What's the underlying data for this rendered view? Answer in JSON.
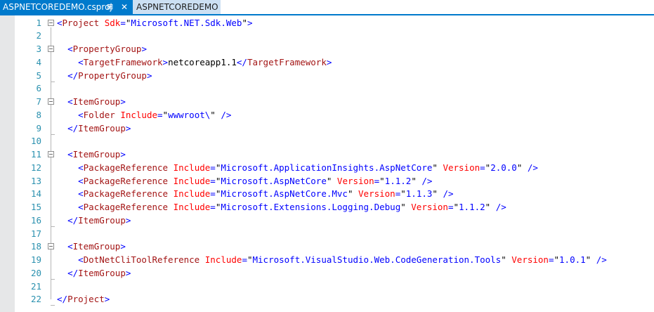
{
  "tabs": [
    {
      "label": "ASPNETCOREDEMO.csproj",
      "active": true,
      "pin_icon": "pin-icon",
      "close_icon": "close-icon"
    },
    {
      "label": "ASPNETCOREDEMO",
      "active": false
    }
  ],
  "colors": {
    "accent": "#007acc",
    "line_number": "#2b91af",
    "tag": "#a31515",
    "attribute": "#ff0000",
    "punctuation": "#0000ff"
  },
  "editor": {
    "line_numbers": [
      "1",
      "2",
      "3",
      "4",
      "5",
      "6",
      "7",
      "8",
      "9",
      "10",
      "11",
      "12",
      "13",
      "14",
      "15",
      "16",
      "17",
      "18",
      "19",
      "20",
      "21",
      "22"
    ],
    "lines": {
      "l1": {
        "open": "<",
        "tag": "Project",
        "sp": " ",
        "attr1": "Sdk",
        "eq1": "=",
        "q1a": "\"",
        "val1": "Microsoft.NET.Sdk.Web",
        "q1b": "\"",
        "close": ">"
      },
      "l3": {
        "indent": "  ",
        "open": "<",
        "tag": "PropertyGroup",
        "close": ">"
      },
      "l4": {
        "indent": "    ",
        "open": "<",
        "tag": "TargetFramework",
        "close": ">",
        "text": "netcoreapp1.1",
        "open2": "</",
        "tag2": "TargetFramework",
        "close2": ">"
      },
      "l5": {
        "indent": "  ",
        "open": "</",
        "tag": "PropertyGroup",
        "close": ">"
      },
      "l7": {
        "indent": "  ",
        "open": "<",
        "tag": "ItemGroup",
        "close": ">"
      },
      "l8": {
        "indent": "    ",
        "open": "<",
        "tag": "Folder",
        "sp": " ",
        "attr1": "Include",
        "eq1": "=",
        "q1a": "\"",
        "val1": "wwwroot\\",
        "q1b": "\"",
        "close": " />"
      },
      "l9": {
        "indent": "  ",
        "open": "</",
        "tag": "ItemGroup",
        "close": ">"
      },
      "l11": {
        "indent": "  ",
        "open": "<",
        "tag": "ItemGroup",
        "close": ">"
      },
      "l12": {
        "indent": "    ",
        "open": "<",
        "tag": "PackageReference",
        "sp": " ",
        "attr1": "Include",
        "eq1": "=",
        "q1a": "\"",
        "val1": "Microsoft.ApplicationInsights.AspNetCore",
        "q1b": "\"",
        "sp2": " ",
        "attr2": "Version",
        "eq2": "=",
        "q2a": "\"",
        "val2": "2.0.0",
        "q2b": "\"",
        "close": " />"
      },
      "l13": {
        "indent": "    ",
        "open": "<",
        "tag": "PackageReference",
        "sp": " ",
        "attr1": "Include",
        "eq1": "=",
        "q1a": "\"",
        "val1": "Microsoft.AspNetCore",
        "q1b": "\"",
        "sp2": " ",
        "attr2": "Version",
        "eq2": "=",
        "q2a": "\"",
        "val2": "1.1.2",
        "q2b": "\"",
        "close": " />"
      },
      "l14": {
        "indent": "    ",
        "open": "<",
        "tag": "PackageReference",
        "sp": " ",
        "attr1": "Include",
        "eq1": "=",
        "q1a": "\"",
        "val1": "Microsoft.AspNetCore.Mvc",
        "q1b": "\"",
        "sp2": " ",
        "attr2": "Version",
        "eq2": "=",
        "q2a": "\"",
        "val2": "1.1.3",
        "q2b": "\"",
        "close": " />"
      },
      "l15": {
        "indent": "    ",
        "open": "<",
        "tag": "PackageReference",
        "sp": " ",
        "attr1": "Include",
        "eq1": "=",
        "q1a": "\"",
        "val1": "Microsoft.Extensions.Logging.Debug",
        "q1b": "\"",
        "sp2": " ",
        "attr2": "Version",
        "eq2": "=",
        "q2a": "\"",
        "val2": "1.1.2",
        "q2b": "\"",
        "close": " />"
      },
      "l16": {
        "indent": "  ",
        "open": "</",
        "tag": "ItemGroup",
        "close": ">"
      },
      "l18": {
        "indent": "  ",
        "open": "<",
        "tag": "ItemGroup",
        "close": ">"
      },
      "l19": {
        "indent": "    ",
        "open": "<",
        "tag": "DotNetCliToolReference",
        "sp": " ",
        "attr1": "Include",
        "eq1": "=",
        "q1a": "\"",
        "val1": "Microsoft.VisualStudio.Web.CodeGeneration.Tools",
        "q1b": "\"",
        "sp2": " ",
        "attr2": "Version",
        "eq2": "=",
        "q2a": "\"",
        "val2": "1.0.1",
        "q2b": "\"",
        "close": " />"
      },
      "l20": {
        "indent": "  ",
        "open": "</",
        "tag": "ItemGroup",
        "close": ">"
      },
      "l22": {
        "open": "</",
        "tag": "Project",
        "close": ">"
      }
    }
  }
}
